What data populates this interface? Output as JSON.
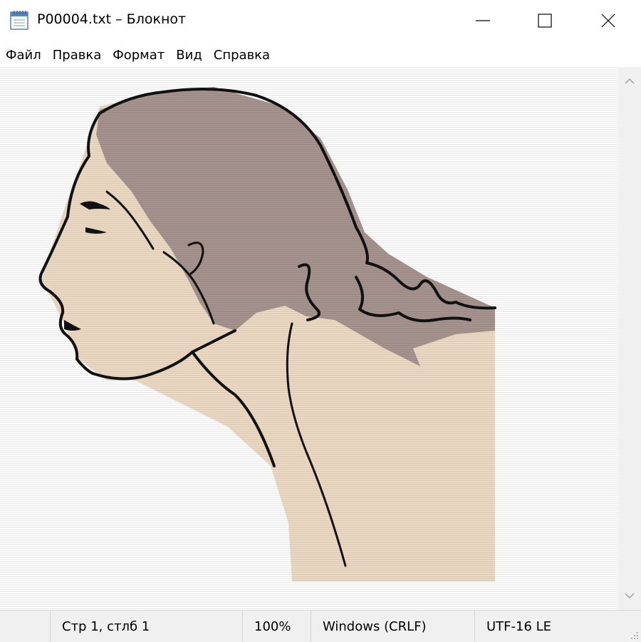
{
  "window": {
    "title": "P00004.txt – Блокнот",
    "icon": "notepad-icon",
    "controls": [
      "minimize-icon",
      "maximize-icon",
      "close-icon"
    ]
  },
  "menu": {
    "items": [
      "Файл",
      "Правка",
      "Формат",
      "Вид",
      "Справка"
    ]
  },
  "editor": {
    "content_type": "ascii-art",
    "colors": {
      "skin": "#efdcc6",
      "hair": "#a89590",
      "outline": "#111111"
    }
  },
  "status": {
    "position": "Стр 1, стлб 1",
    "zoom": "100%",
    "line_endings": "Windows (CRLF)",
    "encoding": "UTF-16 LE"
  }
}
